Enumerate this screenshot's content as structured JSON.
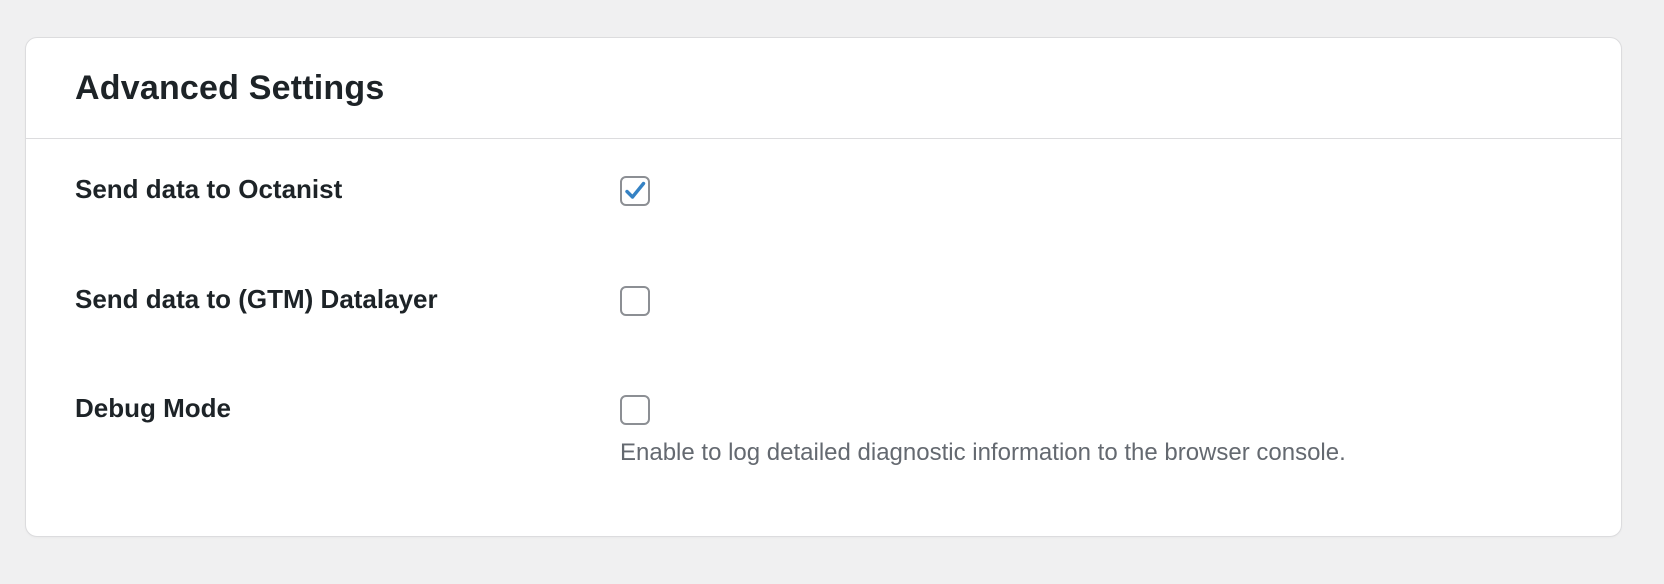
{
  "card": {
    "title": "Advanced Settings"
  },
  "settings": [
    {
      "label": "Send data to Octanist",
      "checked": true,
      "help": ""
    },
    {
      "label": "Send data to (GTM) Datalayer",
      "checked": false,
      "help": ""
    },
    {
      "label": "Debug Mode",
      "checked": false,
      "help": "Enable to log detailed diagnostic information to the browser console."
    }
  ],
  "colors": {
    "background": "#f0f0f1",
    "card": "#ffffff",
    "border": "#dcdcde",
    "text": "#1d2327",
    "muted": "#646970",
    "checkmark": "#3582c4"
  },
  "icons": {
    "checkmark": "checkmark-icon"
  }
}
